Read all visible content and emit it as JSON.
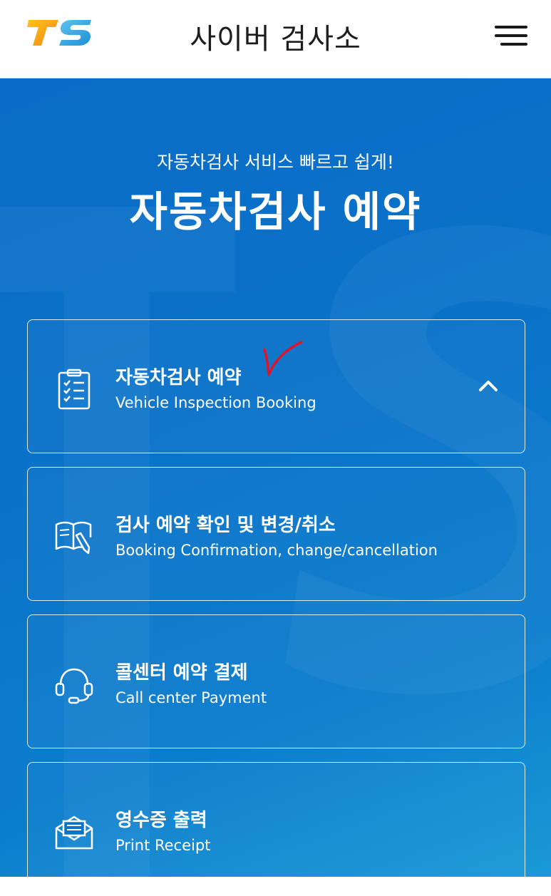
{
  "header": {
    "logo_text": "TS",
    "title": "사이버 검사소"
  },
  "hero": {
    "subtitle": "자동차검사 서비스 빠르고 쉽게!",
    "title": "자동차검사 예약"
  },
  "cards": [
    {
      "title": "자동차검사 예약",
      "subtitle": "Vehicle Inspection Booking",
      "icon": "clipboard-checklist-icon",
      "expanded": true
    },
    {
      "title": "검사 예약 확인 및 변경/취소",
      "subtitle": "Booking Confirmation, change/cancellation",
      "icon": "book-pen-icon"
    },
    {
      "title": "콜센터 예약 결제",
      "subtitle": "Call center Payment",
      "icon": "headset-icon"
    },
    {
      "title": "영수증 출력",
      "subtitle": "Print Receipt",
      "icon": "envelope-receipt-icon"
    }
  ],
  "colors": {
    "hero_blue": "#0a72c9",
    "logo_orange": "#f7a21b",
    "logo_blue": "#3aa9e0",
    "annotation_red": "#e0142a"
  }
}
